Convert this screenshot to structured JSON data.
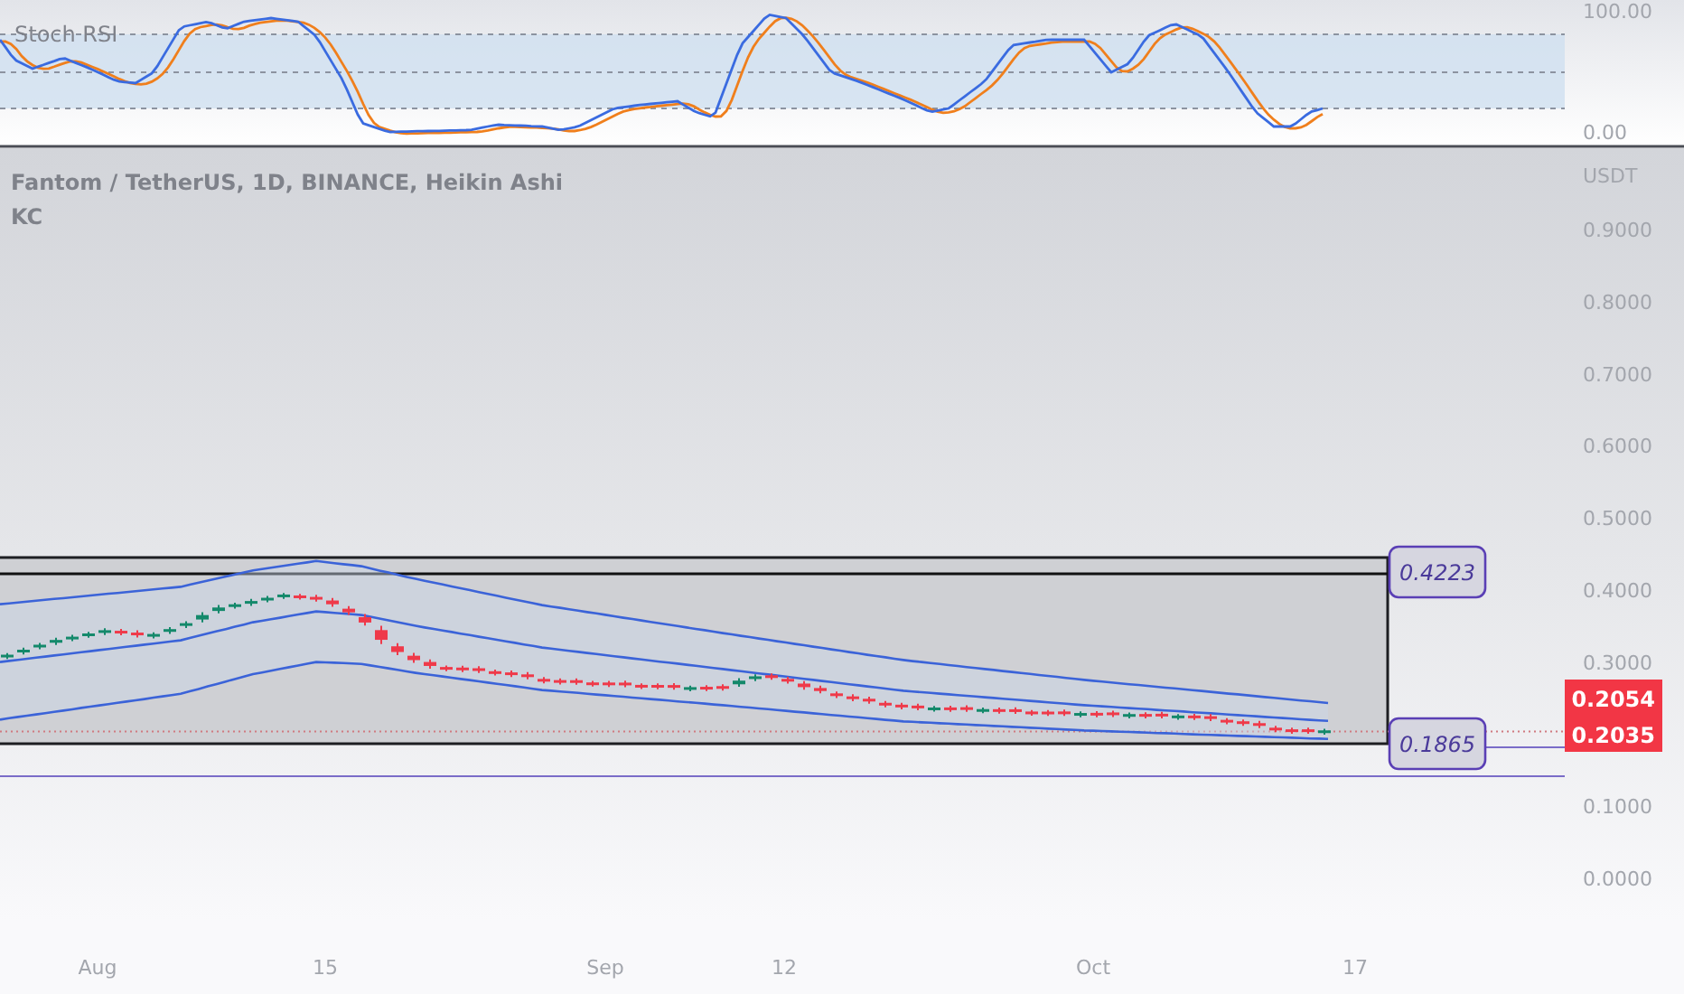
{
  "indicator_pane": {
    "title": "Stoch RSI",
    "axis_labels": [
      "100.00",
      "0.00"
    ]
  },
  "main_pane": {
    "legend": [
      "Fantom / TetherUS, 1D, BINANCE, Heikin Ashi",
      "KC"
    ],
    "axis_unit": "USDT",
    "axis_labels": [
      "0.9000",
      "0.8000",
      "0.7000",
      "0.6000",
      "0.5000",
      "0.4000",
      "0.3000",
      "0.1000",
      "0.0000"
    ],
    "level_labels": [
      "0.4223",
      "0.1865"
    ],
    "price_tags": [
      "0.2054",
      "0.2035"
    ]
  },
  "time_axis": [
    "Aug",
    "15",
    "Sep",
    "12",
    "Oct",
    "17"
  ]
}
